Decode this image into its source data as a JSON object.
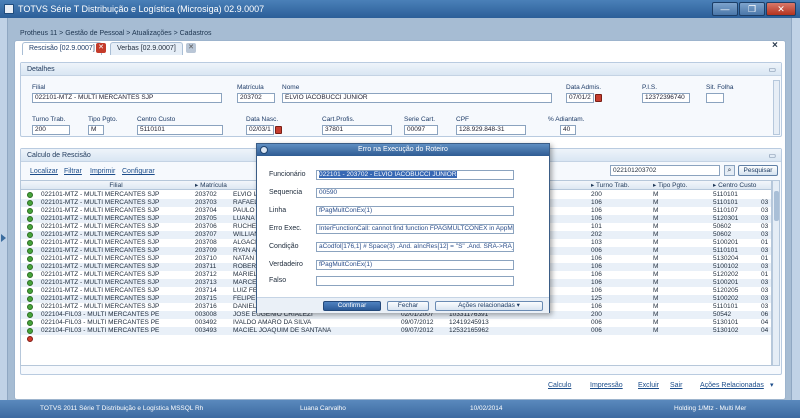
{
  "window": {
    "title": "TOTVS Série T Distribuição e Logística (Microsiga) 02.9.0007",
    "min_label": "—",
    "max_label": "❐",
    "close_label": "✕"
  },
  "breadcrumb": "Protheus 11 > Gestão de Pessoal > Atualizações > Cadastros",
  "tabs": [
    {
      "label": "Rescisão [02.9.0007]"
    },
    {
      "label": "Verbas [02.9.0007]"
    }
  ],
  "panel_close": "×",
  "detalhes": {
    "title": "Detalhes",
    "filial": {
      "label": "Filial",
      "value": "022101-MTZ - MULTI MERCANTES SJP"
    },
    "matricula": {
      "label": "Matrícula",
      "value": "203702"
    },
    "nome": {
      "label": "Nome",
      "value": "ELVIO IACOBUCCI JUNIOR"
    },
    "data_admis": {
      "label": "Data Admis.",
      "value": "07/01/2"
    },
    "pis": {
      "label": "P.I.S.",
      "value": "12372396740"
    },
    "sit_folha": {
      "label": "Sit. Folha",
      "value": ""
    },
    "turno_trab": {
      "label": "Turno Trab.",
      "value": "200"
    },
    "tipo_pgto": {
      "label": "Tipo Pgto.",
      "value": "M"
    },
    "centro_custo": {
      "label": "Centro Custo",
      "value": "5110101"
    },
    "data_nasc": {
      "label": "Data Nasc.",
      "value": "02/03/1"
    },
    "cart_profis": {
      "label": "Cart.Profis.",
      "value": "37801"
    },
    "serie_cart": {
      "label": "Serie Cart.",
      "value": "00097"
    },
    "cpf": {
      "label": "CPF",
      "value": "128.929.848-31"
    },
    "adiantam": {
      "label": "% Adiantam.",
      "value": "40"
    }
  },
  "calculo": {
    "title": "Calculo de Rescisão",
    "toolbar": [
      "Localizar",
      "Filtrar",
      "Imprimir",
      "Configurar"
    ],
    "search_value": "022101203702",
    "search_button": "Pesquisar",
    "headers": {
      "filial": "Filial",
      "matricula": "Matrícula",
      "turno": "Turno Trab.",
      "tipo": "Tipo Pgto.",
      "centro": "Centro Custo"
    },
    "rows": [
      {
        "filial": "022101-MTZ - MULTI MERCANTES SJP",
        "mat": "203702",
        "nome": "ELVIO IAC",
        "data": "",
        "pis": "",
        "turno": "200",
        "tipo": "M",
        "centro": "5110101",
        "cc2": "",
        "status": "green"
      },
      {
        "filial": "022101-MTZ - MULTI MERCANTES SJP",
        "mat": "203703",
        "nome": "RAFAEL NU",
        "data": "",
        "pis": "",
        "turno": "106",
        "tipo": "M",
        "centro": "5110101",
        "cc2": "03",
        "status": "green"
      },
      {
        "filial": "022101-MTZ - MULTI MERCANTES SJP",
        "mat": "203704",
        "nome": "PAULO MA",
        "data": "",
        "pis": "",
        "turno": "106",
        "tipo": "M",
        "centro": "5110107",
        "cc2": "03",
        "status": "green"
      },
      {
        "filial": "022101-MTZ - MULTI MERCANTES SJP",
        "mat": "203705",
        "nome": "LUANA MA",
        "data": "",
        "pis": "",
        "turno": "106",
        "tipo": "M",
        "centro": "5120301",
        "cc2": "03",
        "status": "green"
      },
      {
        "filial": "022101-MTZ - MULTI MERCANTES SJP",
        "mat": "203706",
        "nome": "RUCHELO C",
        "data": "",
        "pis": "",
        "turno": "101",
        "tipo": "M",
        "centro": "50602",
        "cc2": "03",
        "status": "green"
      },
      {
        "filial": "022101-MTZ - MULTI MERCANTES SJP",
        "mat": "203707",
        "nome": "WILLIAN C",
        "data": "",
        "pis": "",
        "turno": "202",
        "tipo": "M",
        "centro": "50602",
        "cc2": "03",
        "status": "green"
      },
      {
        "filial": "022101-MTZ - MULTI MERCANTES SJP",
        "mat": "203708",
        "nome": "ALGACIR B",
        "data": "",
        "pis": "",
        "turno": "103",
        "tipo": "M",
        "centro": "5100201",
        "cc2": "01",
        "status": "green"
      },
      {
        "filial": "022101-MTZ - MULTI MERCANTES SJP",
        "mat": "203709",
        "nome": "RYAN AUG",
        "data": "",
        "pis": "",
        "turno": "006",
        "tipo": "M",
        "centro": "5110101",
        "cc2": "03",
        "status": "green"
      },
      {
        "filial": "022101-MTZ - MULTI MERCANTES SJP",
        "mat": "203710",
        "nome": "NATAN SZU",
        "data": "",
        "pis": "",
        "turno": "106",
        "tipo": "M",
        "centro": "5130204",
        "cc2": "01",
        "status": "green"
      },
      {
        "filial": "022101-MTZ - MULTI MERCANTES SJP",
        "mat": "203711",
        "nome": "ROBERTA R",
        "data": "",
        "pis": "",
        "turno": "106",
        "tipo": "M",
        "centro": "5100102",
        "cc2": "03",
        "status": "green"
      },
      {
        "filial": "022101-MTZ - MULTI MERCANTES SJP",
        "mat": "203712",
        "nome": "MARIELI CA",
        "data": "",
        "pis": "",
        "turno": "106",
        "tipo": "M",
        "centro": "5120202",
        "cc2": "01",
        "status": "green"
      },
      {
        "filial": "022101-MTZ - MULTI MERCANTES SJP",
        "mat": "203713",
        "nome": "MARCEL VA",
        "data": "",
        "pis": "",
        "turno": "106",
        "tipo": "M",
        "centro": "5100201",
        "cc2": "03",
        "status": "green"
      },
      {
        "filial": "022101-MTZ - MULTI MERCANTES SJP",
        "mat": "203714",
        "nome": "LUIZ FERN",
        "data": "",
        "pis": "",
        "turno": "106",
        "tipo": "M",
        "centro": "5120205",
        "cc2": "03",
        "status": "green"
      },
      {
        "filial": "022101-MTZ - MULTI MERCANTES SJP",
        "mat": "203715",
        "nome": "FELIPE OLIVEIRA DE CASTRO",
        "data": "03/02/2014",
        "pis": "13051743509",
        "turno": "125",
        "tipo": "M",
        "centro": "5100202",
        "cc2": "03",
        "status": "green"
      },
      {
        "filial": "022101-MTZ - MULTI MERCANTES SJP",
        "mat": "203716",
        "nome": "DANIELLE CAROLINE RODRIGUES",
        "data": "10/02/2014",
        "pis": "12849905517",
        "turno": "106",
        "tipo": "M",
        "centro": "5110101",
        "cc2": "03",
        "status": "green"
      },
      {
        "filial": "022104-FIL03 - MULTI MERCANTES PE",
        "mat": "003008",
        "nome": "JOSE EUGENIO CRIALEZI",
        "data": "02/01/2007",
        "pis": "10331176391",
        "turno": "200",
        "tipo": "M",
        "centro": "50542",
        "cc2": "06",
        "status": "green"
      },
      {
        "filial": "022104-FIL03 - MULTI MERCANTES PE",
        "mat": "003492",
        "nome": "IVALDO AMARO DA SILVA",
        "data": "09/07/2012",
        "pis": "12419245913",
        "turno": "006",
        "tipo": "M",
        "centro": "5130101",
        "cc2": "04",
        "status": "green"
      },
      {
        "filial": "022104-FIL03 - MULTI MERCANTES PE",
        "mat": "003493",
        "nome": "MACIEL JOAQUIM DE SANTANA",
        "data": "09/07/2012",
        "pis": "12532165962",
        "turno": "006",
        "tipo": "M",
        "centro": "5130102",
        "cc2": "04",
        "status": "green"
      },
      {
        "filial": "",
        "mat": "",
        "nome": "",
        "data": "",
        "pis": "",
        "turno": "",
        "tipo": "",
        "centro": "",
        "cc2": "",
        "status": "red"
      }
    ]
  },
  "dialog": {
    "title": "Erro na Execução do Roteiro",
    "funcionario": {
      "label": "Funcionário",
      "value": "022101 - 203702 - ELVIO IACOBUCCI JUNIOR"
    },
    "sequencia": {
      "label": "Sequencia",
      "value": "00590"
    },
    "linha": {
      "label": "Linha",
      "value": "fPagMultConEx(1)"
    },
    "erro_exec": {
      "label": "Erro Exec.",
      "value": "InterFunctionCall: cannot find function FPAGMULTCONEX in AppMap Fi"
    },
    "condicao": {
      "label": "Condição",
      "value": "aCodfol[176,1] # Space(3) .And. aIncRes[12] = \"S\" .And. SRA->RA_V"
    },
    "verdadeiro": {
      "label": "Verdadeiro",
      "value": "fPagMultConEx(1)"
    },
    "falso": {
      "label": "Falso",
      "value": ""
    },
    "confirm": "Confirmar",
    "fechar": "Fechar",
    "acoes": "Ações relacionadas"
  },
  "bottom_links": [
    "Calculo",
    "Impressão",
    "Excluir",
    "Sair",
    "Ações Relacionadas"
  ],
  "status": {
    "product": "TOTVS 2011 Série T Distribuição e Logística MSSQL Rh",
    "user": "Luana Carvalho",
    "date": "10/02/2014",
    "company": "Holding 1/Mtz - Multi Mer"
  }
}
